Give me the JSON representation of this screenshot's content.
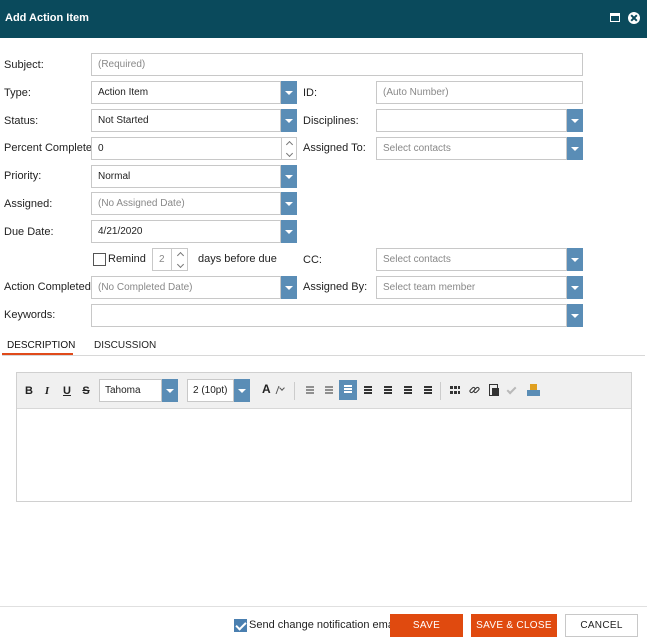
{
  "window": {
    "title": "Add Action Item"
  },
  "form": {
    "subject": {
      "label": "Subject:",
      "placeholder": "(Required)"
    },
    "type": {
      "label": "Type:",
      "value": "Action Item"
    },
    "id": {
      "label": "ID:",
      "placeholder": "(Auto Number)"
    },
    "status": {
      "label": "Status:",
      "value": "Not Started"
    },
    "disciplines": {
      "label": "Disciplines:",
      "value": ""
    },
    "percent_complete": {
      "label": "Percent Complete:",
      "value": "0"
    },
    "assigned_to": {
      "label": "Assigned To:",
      "placeholder": "Select contacts"
    },
    "priority": {
      "label": "Priority:",
      "value": "Normal"
    },
    "assigned": {
      "label": "Assigned:",
      "placeholder": "(No Assigned Date)"
    },
    "due_date": {
      "label": "Due Date:",
      "value": "4/21/2020"
    },
    "remind": {
      "label": "Remind",
      "checked": false,
      "days": "2",
      "suffix": "days before due"
    },
    "cc": {
      "label": "CC:",
      "placeholder": "Select contacts"
    },
    "action_completed": {
      "label": "Action Completed:",
      "placeholder": "(No Completed Date)"
    },
    "assigned_by": {
      "label": "Assigned By:",
      "placeholder": "Select team member"
    },
    "keywords": {
      "label": "Keywords:",
      "value": ""
    }
  },
  "tabs": [
    {
      "label": "DESCRIPTION",
      "active": true
    },
    {
      "label": "DISCUSSION",
      "active": false
    }
  ],
  "editor": {
    "bold": "B",
    "italic": "I",
    "underline": "U",
    "strike": "S",
    "font": "Tahoma",
    "size": "2 (10pt)",
    "content": ""
  },
  "footer": {
    "notify_label": "Send change notification email",
    "notify_checked": true,
    "save": "SAVE",
    "save_close": "SAVE & CLOSE",
    "cancel": "CANCEL"
  },
  "colors": {
    "titlebar": "#0a4a5c",
    "dropdown": "#5a8db6",
    "primary": "#e04a0f"
  }
}
